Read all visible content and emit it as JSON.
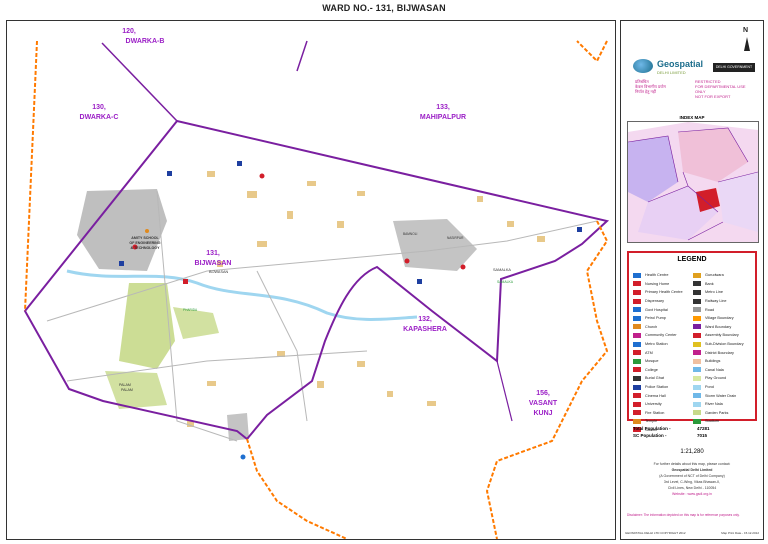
{
  "title": "WARD NO.- 131, BIJWASAN",
  "map": {
    "wards": [
      {
        "number": "120,",
        "name": "DWARKA-B"
      },
      {
        "number": "130,",
        "name": "DWARKA-C"
      },
      {
        "number": "133,",
        "name": "MAHIPALPUR"
      },
      {
        "number": "131,",
        "name": "BIJWASAN"
      },
      {
        "number": "132,",
        "name": "KAPASHERA"
      },
      {
        "number": "156,",
        "name": "VASANT",
        "name2": "KUNJ"
      }
    ],
    "places": [
      "AMITY SCHOOL",
      "OF ENGINEERING",
      "& TECHNOLOGY",
      "BIJWASAN",
      "SAMALKA",
      "SAMALKA",
      "PALAM",
      "PALAM",
      "PHARIDA",
      "NASIRPUR",
      "BAMNOLI"
    ],
    "colors": {
      "ward_boundary": "#7a1fa0",
      "district_boundary": "#ff7a00",
      "ward_label": "#9b1fc6",
      "water": "#9fd6f0",
      "park": "#c7d98a",
      "builtup": "#8a8a8a"
    }
  },
  "panel": {
    "north": "N",
    "logo": {
      "name": "Geospatial",
      "sub": "DELHI LIMITED",
      "govt": "DELHI GOVERNMENT"
    },
    "restricted": [
      "RESTRICTED",
      "FOR DEPARTMENTAL USE ONLY",
      "NOT FOR EXPORT"
    ],
    "hindi": [
      "प्रतिबंधित",
      "केवल विभागीय प्रयोग",
      "निर्यात हेतु नहीं"
    ],
    "index_title": "INDEX MAP",
    "legend_title": "LEGEND",
    "legend_left": [
      {
        "label": "Health Centre",
        "color": "#1e6fd0"
      },
      {
        "label": "Nursing Home",
        "color": "#d21e2a"
      },
      {
        "label": "Primary Health Centre",
        "color": "#d21e2a"
      },
      {
        "label": "Dispensary",
        "color": "#d21e2a"
      },
      {
        "label": "Govt Hospital",
        "color": "#1e6fd0"
      },
      {
        "label": "Petrol Pump",
        "color": "#1e6fd0"
      },
      {
        "label": "Church",
        "color": "#e08a1e"
      },
      {
        "label": "Community Center",
        "color": "#c0208c"
      },
      {
        "label": "Metro Station",
        "color": "#1e6fd0"
      },
      {
        "label": "ATM",
        "color": "#d21e2a"
      },
      {
        "label": "Mosque",
        "color": "#2a9a3a"
      },
      {
        "label": "College",
        "color": "#d21e2a"
      },
      {
        "label": "Burial Ghat",
        "color": "#333333"
      },
      {
        "label": "Police Station",
        "color": "#1e3fa0"
      },
      {
        "label": "Cinema Hall",
        "color": "#d21e2a"
      },
      {
        "label": "University",
        "color": "#d21e2a"
      },
      {
        "label": "Fire Station",
        "color": "#d21e2a"
      },
      {
        "label": "Temple",
        "color": "#e08a1e"
      },
      {
        "label": "School",
        "color": "#d21e2a"
      }
    ],
    "legend_right": [
      {
        "label": "Gurudwara",
        "color": "#e0a01e"
      },
      {
        "label": "Bank",
        "color": "#333333"
      },
      {
        "label": "Metro Line",
        "color": "#333333"
      },
      {
        "label": "Railway Line",
        "color": "#333333"
      },
      {
        "label": "Road",
        "color": "#999999"
      },
      {
        "label": "Village Boundary",
        "color": "#ff9900"
      },
      {
        "label": "Ward Boundary",
        "color": "#7a1fa0"
      },
      {
        "label": "Assembly Boundary",
        "color": "#d21e2a"
      },
      {
        "label": "Sub-Division Boundary",
        "color": "#e0c020"
      },
      {
        "label": "District Boundary",
        "color": "#c0208c"
      },
      {
        "label": "Buildings",
        "color": "#f0c0a0"
      },
      {
        "label": "Canal Nala",
        "color": "#6fb8e8"
      },
      {
        "label": "Play Ground",
        "color": "#d8e8a0"
      },
      {
        "label": "Pond",
        "color": "#9fd6f0"
      },
      {
        "label": "Storm Water Drain",
        "color": "#6fb8e8"
      },
      {
        "label": "River Nala",
        "color": "#9fd6f0"
      },
      {
        "label": "Garden Parks",
        "color": "#c7d98a"
      },
      {
        "label": "Stadium",
        "color": "#2a9a3a"
      }
    ],
    "population": [
      {
        "label": "Total Population -",
        "value": "47281"
      },
      {
        "label": "SC Population -",
        "value": "7015"
      }
    ],
    "scale": "1:21,280",
    "contact": [
      "For further details about this map, please contact:",
      "Geospatial Delhi Limited",
      "(A Government of NCT of Delhi Company)",
      "3rd Level, C-Wing, Vikas Bhawan-II,",
      "Civil Lines, New Delhi - 110054",
      "Website : www.gsdl.org.in"
    ],
    "disclaimer": "Disclaimer: The information depicted on this map is for reference purposes only.",
    "footer": "GEOSPATIAL DELHI LTD COPYRIGHT 2012",
    "footer_right": "Map Print Date - 15.12.2012"
  }
}
